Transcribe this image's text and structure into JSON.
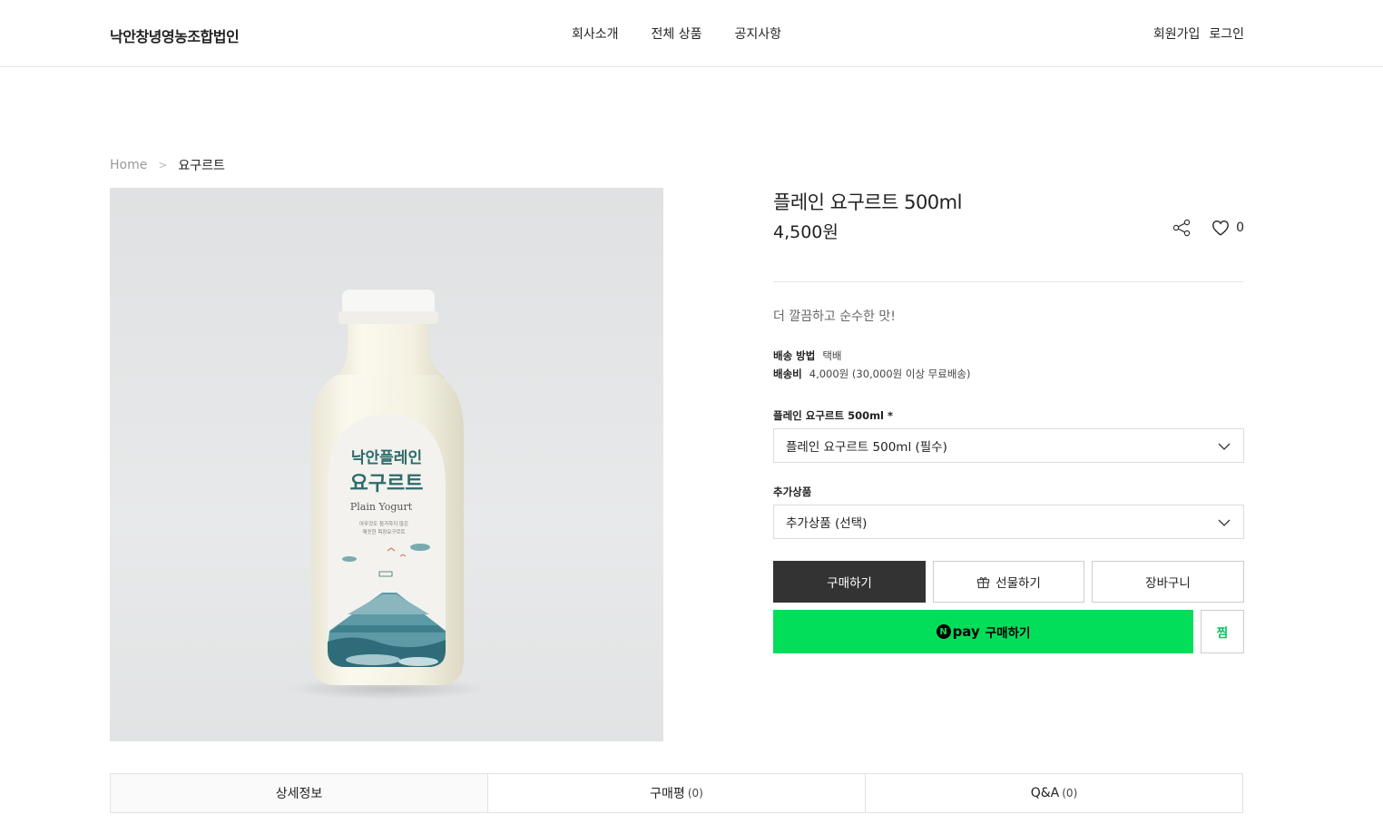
{
  "header": {
    "logo": "낙안창녕영농조합법인",
    "nav": [
      "회사소개",
      "전체 상품",
      "공지사항"
    ],
    "member": [
      "회원가입",
      "로그인"
    ]
  },
  "breadcrumb": {
    "home": "Home",
    "current": "요구르트"
  },
  "product": {
    "image_label_title": "낙안플레인",
    "image_label_sub": "요구르트",
    "image_label_en": "Plain Yogurt",
    "image_label_desc1": "아무것도 첨가하지 않은",
    "image_label_desc2": "깨끗한 목장요구르트",
    "title": "플레인 요구르트 500ml",
    "price": "4,500원",
    "like_count": "0",
    "summary": "더 깔끔하고 순수한 맛!",
    "shipping_method_label": "배송 방법",
    "shipping_method": "택배",
    "shipping_fee_label": "배송비",
    "shipping_fee": "4,000원 (30,000원 이상 무료배송)",
    "option1_label": "플레인 요구르트 500ml *",
    "option1_value": "플레인 요구르트 500ml (필수)",
    "option2_label": "추가상품",
    "option2_value": "추가상품 (선택)"
  },
  "buttons": {
    "buy": "구매하기",
    "gift": "선물하기",
    "cart": "장바구니",
    "npay_badge": "N",
    "npay_word": "pay",
    "npay_label": "구매하기",
    "zzim": "찜"
  },
  "tabs": [
    {
      "label": "상세정보",
      "count": ""
    },
    {
      "label": "구매평",
      "count": "(0)"
    },
    {
      "label": "Q&A",
      "count": "(0)"
    }
  ],
  "colors": {
    "npay": "#03de5a",
    "buy": "#333333",
    "zzim": "#03c75a"
  }
}
